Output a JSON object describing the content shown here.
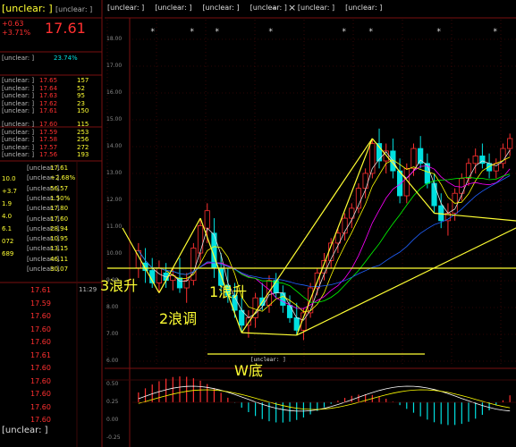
{
  "app": {
    "stock_title": "[unclear: ]",
    "code": "[unclear: ]",
    "price": "17.61",
    "change": "+0.63",
    "change_pct": "+3.71%"
  },
  "toolbar": {
    "items": [
      "[unclear: ]",
      "[unclear: ]",
      "[unclear: ]",
      "[unclear: ]",
      "[unclear: ]",
      "[unclear: ]"
    ],
    "close_icon": "close-icon",
    "minimize_icon": "minimize-icon"
  },
  "order_book": {
    "sell": [
      {
        "label": "[unclear: ]",
        "price": "17.65",
        "vol": "157"
      },
      {
        "label": "[unclear: ]",
        "price": "17.64",
        "vol": "52"
      },
      {
        "label": "[unclear: ]",
        "price": "17.63",
        "vol": "95"
      },
      {
        "label": "[unclear: ]",
        "price": "17.62",
        "vol": "23"
      },
      {
        "label": "[unclear: ]",
        "price": "17.61",
        "vol": "150"
      }
    ],
    "buy": [
      {
        "label": "[unclear: ]",
        "price": "17.60",
        "vol": "115"
      },
      {
        "label": "[unclear: ]",
        "price": "17.59",
        "vol": "253"
      },
      {
        "label": "[unclear: ]",
        "price": "17.58",
        "vol": "256"
      },
      {
        "label": "[unclear: ]",
        "price": "17.57",
        "vol": "272"
      },
      {
        "label": "[unclear: ]",
        "price": "17.56",
        "vol": "193"
      }
    ],
    "ratio_label": "[unclear: ]",
    "ratio_value": "23.74%"
  },
  "quote_fields": [
    {
      "label": "[unclear: ]",
      "value": "17.61"
    },
    {
      "label": "[unclear: ]",
      "value": "+2.68%"
    },
    {
      "label": "[unclear: ]",
      "value": "56.57"
    },
    {
      "label": "[unclear: ]",
      "value": "1.50%"
    },
    {
      "label": "[unclear: ]",
      "value": "17.80"
    },
    {
      "label": "[unclear: ]",
      "value": "17.60"
    },
    {
      "label": "[unclear: ]",
      "value": "28.94"
    },
    {
      "label": "[unclear: ]",
      "value": "10.95"
    },
    {
      "label": "[unclear: ]",
      "value": "13.15"
    },
    {
      "label": "[unclear: ]",
      "value": "46.11"
    },
    {
      "label": "[unclear: ]",
      "value": "30.07"
    }
  ],
  "left_col_values": [
    "10.0",
    "+3.7",
    "1.9",
    "4.0",
    "6.1",
    "072",
    "689"
  ],
  "ticks": {
    "time": "11:29",
    "prices": [
      "17.61",
      "17.59",
      "17.60",
      "17.60",
      "17.60",
      "17.61",
      "17.60",
      "17.60",
      "17.60",
      "17.60",
      "17.60"
    ]
  },
  "right_col_headers": [
    "[unclear: ]",
    "[unclear: ]"
  ],
  "y_axis_main": [
    "18.00",
    "17.00",
    "16.00",
    "15.00",
    "14.00",
    "13.00",
    "12.00",
    "11.00",
    "10.00",
    "9.00",
    "8.00",
    "7.00",
    "6.00"
  ],
  "y_axis_macd": [
    "0.50",
    "0.25",
    "0.00",
    "-0.25"
  ],
  "chart_data": {
    "type": "candlestick",
    "title": "",
    "ylim": [
      6,
      19
    ],
    "candles": [
      {
        "o": 9.6,
        "h": 10.6,
        "l": 9.2,
        "c": 10.3
      },
      {
        "o": 9.8,
        "h": 10.4,
        "l": 9.0,
        "c": 9.5
      },
      {
        "o": 9.5,
        "h": 10.0,
        "l": 8.8,
        "c": 9.0
      },
      {
        "o": 9.0,
        "h": 9.9,
        "l": 8.6,
        "c": 9.6
      },
      {
        "o": 9.4,
        "h": 9.8,
        "l": 8.8,
        "c": 9.1
      },
      {
        "o": 9.1,
        "h": 9.6,
        "l": 8.7,
        "c": 9.3
      },
      {
        "o": 9.2,
        "h": 10.0,
        "l": 8.6,
        "c": 8.8
      },
      {
        "o": 8.8,
        "h": 9.4,
        "l": 8.2,
        "c": 9.1
      },
      {
        "o": 9.1,
        "h": 10.6,
        "l": 8.9,
        "c": 10.4
      },
      {
        "o": 10.2,
        "h": 11.6,
        "l": 9.8,
        "c": 11.3
      },
      {
        "o": 11.2,
        "h": 12.2,
        "l": 10.6,
        "c": 11.9
      },
      {
        "o": 11.0,
        "h": 11.6,
        "l": 9.2,
        "c": 9.6
      },
      {
        "o": 9.6,
        "h": 10.2,
        "l": 8.6,
        "c": 8.9
      },
      {
        "o": 8.9,
        "h": 9.6,
        "l": 8.2,
        "c": 8.5
      },
      {
        "o": 8.5,
        "h": 9.0,
        "l": 7.6,
        "c": 7.9
      },
      {
        "o": 7.9,
        "h": 8.4,
        "l": 7.0,
        "c": 7.3
      },
      {
        "o": 7.3,
        "h": 7.9,
        "l": 6.8,
        "c": 7.6
      },
      {
        "o": 7.6,
        "h": 8.6,
        "l": 7.2,
        "c": 8.4
      },
      {
        "o": 8.4,
        "h": 9.0,
        "l": 7.9,
        "c": 8.1
      },
      {
        "o": 8.1,
        "h": 9.3,
        "l": 7.8,
        "c": 9.1
      },
      {
        "o": 9.1,
        "h": 9.4,
        "l": 8.4,
        "c": 8.6
      },
      {
        "o": 8.6,
        "h": 8.9,
        "l": 7.8,
        "c": 8.1
      },
      {
        "o": 8.1,
        "h": 8.5,
        "l": 7.4,
        "c": 7.6
      },
      {
        "o": 7.6,
        "h": 8.2,
        "l": 6.9,
        "c": 7.1
      },
      {
        "o": 7.1,
        "h": 8.0,
        "l": 6.7,
        "c": 7.8
      },
      {
        "o": 7.8,
        "h": 9.0,
        "l": 7.6,
        "c": 8.8
      },
      {
        "o": 8.8,
        "h": 9.6,
        "l": 8.5,
        "c": 9.4
      },
      {
        "o": 9.4,
        "h": 10.2,
        "l": 9.1,
        "c": 9.9
      },
      {
        "o": 9.9,
        "h": 10.8,
        "l": 9.6,
        "c": 10.6
      },
      {
        "o": 10.6,
        "h": 11.2,
        "l": 10.2,
        "c": 11.0
      },
      {
        "o": 11.0,
        "h": 11.8,
        "l": 10.7,
        "c": 11.6
      },
      {
        "o": 11.6,
        "h": 12.2,
        "l": 11.2,
        "c": 12.0
      },
      {
        "o": 12.0,
        "h": 13.0,
        "l": 11.8,
        "c": 12.8
      },
      {
        "o": 12.8,
        "h": 13.6,
        "l": 12.4,
        "c": 13.4
      },
      {
        "o": 13.4,
        "h": 14.8,
        "l": 13.2,
        "c": 14.6
      },
      {
        "o": 14.6,
        "h": 15.2,
        "l": 13.6,
        "c": 13.9
      },
      {
        "o": 13.9,
        "h": 14.6,
        "l": 13.4,
        "c": 14.3
      },
      {
        "o": 14.3,
        "h": 14.8,
        "l": 13.2,
        "c": 13.5
      },
      {
        "o": 13.5,
        "h": 14.0,
        "l": 12.2,
        "c": 12.5
      },
      {
        "o": 12.5,
        "h": 13.8,
        "l": 12.2,
        "c": 13.6
      },
      {
        "o": 13.6,
        "h": 14.6,
        "l": 13.3,
        "c": 14.4
      },
      {
        "o": 14.4,
        "h": 14.9,
        "l": 13.6,
        "c": 13.8
      },
      {
        "o": 13.8,
        "h": 14.2,
        "l": 12.8,
        "c": 13.0
      },
      {
        "o": 13.0,
        "h": 13.4,
        "l": 11.8,
        "c": 12.1
      },
      {
        "o": 12.1,
        "h": 12.6,
        "l": 11.2,
        "c": 11.5
      },
      {
        "o": 11.5,
        "h": 12.2,
        "l": 10.9,
        "c": 11.8
      },
      {
        "o": 11.8,
        "h": 12.8,
        "l": 11.5,
        "c": 12.6
      },
      {
        "o": 12.6,
        "h": 13.4,
        "l": 12.3,
        "c": 13.2
      },
      {
        "o": 13.2,
        "h": 14.0,
        "l": 12.9,
        "c": 13.8
      },
      {
        "o": 13.8,
        "h": 14.4,
        "l": 13.4,
        "c": 14.1
      },
      {
        "o": 14.1,
        "h": 14.6,
        "l": 13.6,
        "c": 13.8
      },
      {
        "o": 13.8,
        "h": 14.2,
        "l": 13.2,
        "c": 13.5
      },
      {
        "o": 13.5,
        "h": 14.0,
        "l": 13.2,
        "c": 13.8
      },
      {
        "o": 13.8,
        "h": 14.6,
        "l": 13.6,
        "c": 14.4
      },
      {
        "o": 14.4,
        "h": 15.0,
        "l": 14.1,
        "c": 14.8
      }
    ],
    "annotations": [
      "3浪升",
      "2浪调",
      "1浪升",
      "W底"
    ],
    "low_label": "[unclear: ]"
  },
  "colors": {
    "up": "#ff3030",
    "down": "#00e0e0",
    "annotation": "#ffff33",
    "ma1": "#e0e0e0",
    "ma2": "#ffff00",
    "ma3": "#ff00ff",
    "ma4": "#00ff00",
    "ma5": "#2060ff",
    "grid": "#7a1010"
  },
  "watermark": "[unclear: ]"
}
